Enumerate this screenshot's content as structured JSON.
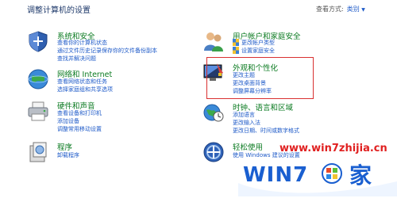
{
  "header": {
    "title": "调整计算机的设置"
  },
  "view_by": {
    "label": "查看方式:",
    "value": "类别"
  },
  "categories": [
    {
      "title": "系统和安全",
      "links": [
        "查看你的计算机状态",
        "通过文件历史记录保存你的文件备份副本",
        "查找并解决问题"
      ]
    },
    {
      "title": "网络和 Internet",
      "links": [
        "查看网络状态和任务",
        "选择家庭组和共享选项"
      ]
    },
    {
      "title": "硬件和声音",
      "links": [
        "查看设备和打印机",
        "添加设备",
        "调整常用移动设置"
      ]
    },
    {
      "title": "程序",
      "links": [
        "卸载程序"
      ]
    },
    {
      "title": "用户帐户和家庭安全",
      "links": [
        "更改帐户类型",
        "设置家庭安全"
      ]
    },
    {
      "title": "外观和个性化",
      "links": [
        "更改主题",
        "更改桌面背景",
        "调整屏幕分辨率"
      ]
    },
    {
      "title": "时钟、语言和区域",
      "links": [
        "添加语言",
        "更改输入法",
        "更改日期、时间或数字格式"
      ]
    },
    {
      "title": "轻松使用",
      "links": [
        "使用 Windows 建议的设置"
      ]
    }
  ],
  "watermark": {
    "url": "www.win7zhijia.cn",
    "logo_text": "WIN7",
    "logo_char": "家"
  },
  "colors": {
    "heading": "#0a7a20",
    "link": "#1e5ac8",
    "highlight": "#d93030",
    "watermark": "#e02020",
    "logo": "#1a5fd0"
  }
}
